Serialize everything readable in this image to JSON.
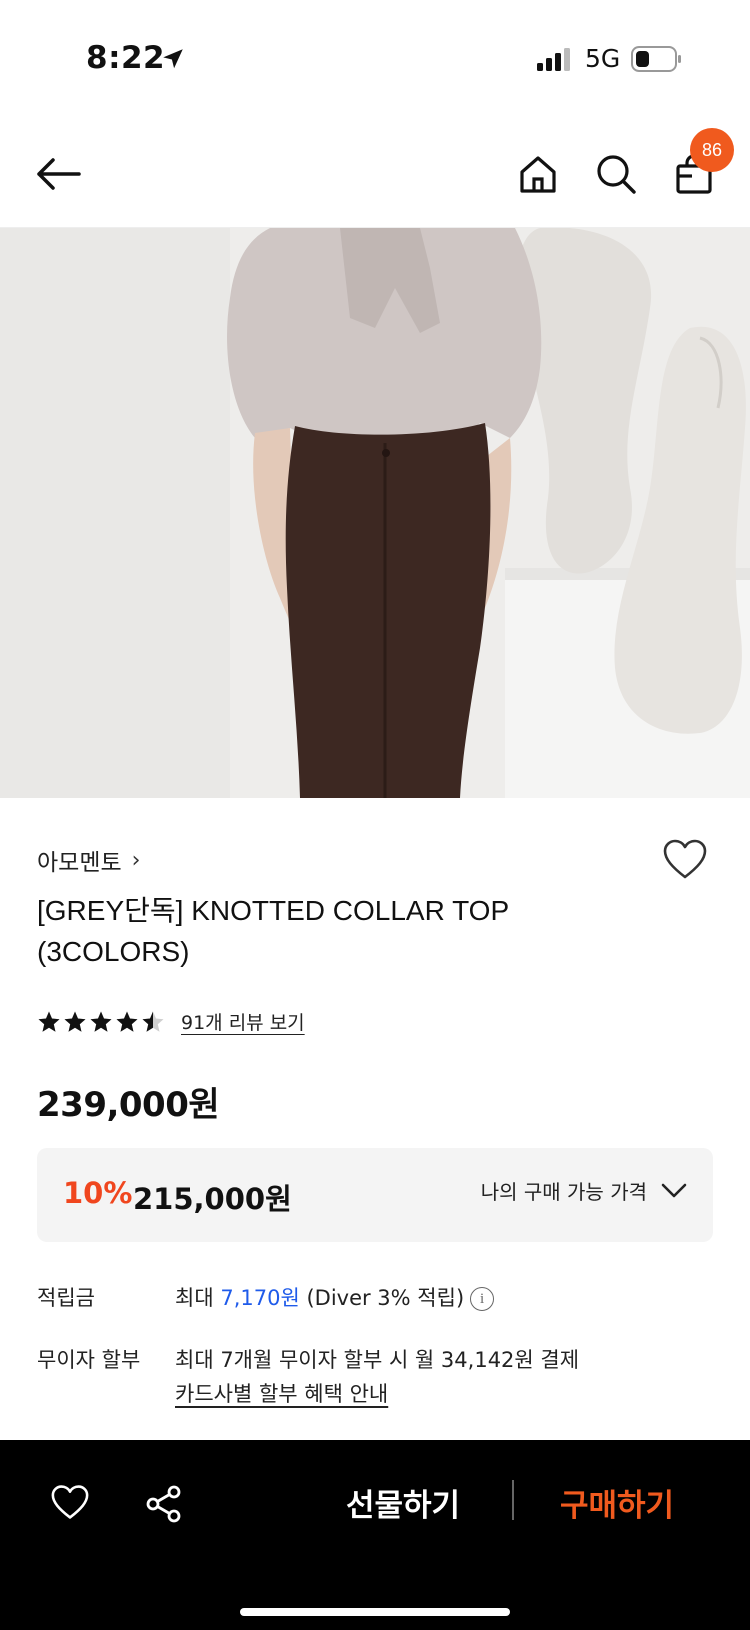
{
  "status_bar": {
    "time": "8:22",
    "network": "5G",
    "icons": [
      "location-arrow-icon",
      "signal-icon",
      "battery-icon"
    ]
  },
  "nav": {
    "icons": [
      "back-arrow-icon",
      "home-icon",
      "search-icon",
      "shopping-bag-icon"
    ],
    "cart_count": "86"
  },
  "product": {
    "brand": "아모멘토",
    "title": "[GREY단독] KNOTTED COLLAR TOP (3COLORS)",
    "rating": 4.5,
    "review_link": "91개 리뷰 보기",
    "price": "239,000원",
    "discount_rate": "10%",
    "discount_price": "215,000원",
    "my_price_label": "나의 구매 가능 가격"
  },
  "benefits": {
    "points_label": "적립금",
    "points_prefix": "최대 ",
    "points_amount": "7,170원",
    "points_suffix": " (Diver 3% 적립)",
    "installment_label": "무이자 할부",
    "installment_text": "최대 7개월 무이자 할부 시 월 34,142원 결제",
    "installment_link": "카드사별 할부 혜택 안내"
  },
  "bottom_bar": {
    "gift_label": "선물하기",
    "buy_label": "구매하기"
  },
  "colors": {
    "accent_orange": "#f05a1e",
    "discount_red": "#f0461e",
    "link_blue": "#1f5bea"
  }
}
